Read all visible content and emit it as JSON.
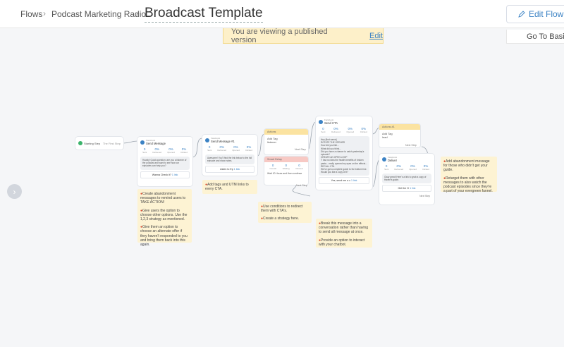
{
  "header": {
    "crumbs": [
      "Flows",
      "Podcast Marketing Radio"
    ],
    "title": "Broadcast Template",
    "edit_flow_label": "Edit Flow",
    "go_basic_label": "Go To Basic"
  },
  "banner": {
    "text": "You are viewing a published version",
    "edit_label": "Edit"
  },
  "nodes": {
    "start": {
      "label": "Starting Step",
      "next": "The First Step"
    },
    "send1": {
      "sub": "Facebook",
      "name": "Send Message",
      "stats": [
        {
          "v": "0",
          "l": "Sent"
        },
        {
          "v": "0%",
          "l": "Delivered"
        },
        {
          "v": "0%",
          "l": "Opened"
        },
        {
          "v": "0%",
          "l": "Clicked"
        }
      ],
      "msg": "Howdy! Quick question: are you a listener of the podcast and want to see how our episodes can help you?",
      "button": "Wanna Check it?",
      "link": "1 link",
      "notes": [
        "Create abandonment messages to remind users to TAKE ACTION!",
        "Give users the option to choose other options. Use the 1,2,3 strategy as mentioned.",
        "Give them an option to choose an alternate offer if they haven't responded to you and bring them back into this again."
      ]
    },
    "send2": {
      "sub": "Facebook",
      "name": "Send Message #1",
      "stats": [
        {
          "v": "0",
          "l": "Sent"
        },
        {
          "v": "0%",
          "l": "Delivered"
        },
        {
          "v": "0%",
          "l": "Opened"
        },
        {
          "v": "0%",
          "l": "Clicked"
        }
      ],
      "msg": "Awesome! You'll find the link below to the full episode and show notes.",
      "button": "Listen to Ep",
      "link": "1 link",
      "notes": [
        "Add tags and UTM links to every CTA."
      ]
    },
    "actions1": {
      "bar": "Actions",
      "line1": "Add Tag",
      "line2": "listener"
    },
    "delay": {
      "bar": "Smart Delay",
      "stats": [
        {
          "v": "0",
          "l": "Overall"
        },
        {
          "v": "0",
          "l": "Waiting"
        },
        {
          "v": "0",
          "l": "Passed"
        }
      ],
      "text": "Wait 10 Hours and then continue",
      "notes": [
        "Use conditions to redirect them with CTA's.",
        "Create a strategy here."
      ]
    },
    "cta": {
      "sub": "Facebook",
      "name": "Send CTA",
      "stats": [
        {
          "v": "0",
          "l": "Sent"
        },
        {
          "v": "0%",
          "l": "Delivered"
        },
        {
          "v": "0%",
          "l": "Opened"
        },
        {
          "v": "0%",
          "l": "Clicked"
        }
      ],
      "lines": [
        "Hey {first name}",
        "ROTATE THE OPENER",
        "How did you like...",
        "What did you think...",
        "Did you have a chance to catch yesterday's episode?",
        "CREATE AN OPEN LOOP",
        "\"I had no idea the health benefits of broken pasta... really opened my eyes on the effects...",
        "RECALL CTA",
        "We've got a complete guide to the bottom line. Would you like a copy of it?"
      ],
      "button": "Yes, send me a c",
      "link": "1 link",
      "next": "Next Step",
      "notes": [
        "Break this message into a conversation rather than having to send all message at once.",
        "Provide an option to interact with your chatbot."
      ]
    },
    "actions2": {
      "bar": "Actions #1",
      "line1": "Add Tag",
      "line2": "lead"
    },
    "deliver": {
      "sub": "Facebook",
      "name": "Deliver",
      "stats": [
        {
          "v": "0",
          "l": "Sent"
        },
        {
          "v": "0%",
          "l": "Delivered"
        },
        {
          "v": "0%",
          "l": "Opened"
        },
        {
          "v": "0%",
          "l": "Clicked"
        }
      ],
      "msg": "Okay great! Here's a link to grab a copy of Haven's guide.",
      "button": "Get the G",
      "link": "1 link",
      "next": "Next Step",
      "notes": [
        "Add abandonment message for those who didn't get your guide.",
        "Retarget them with other messages to also watch the podcast episodes since they're a part of your evergreen funnel."
      ]
    }
  }
}
